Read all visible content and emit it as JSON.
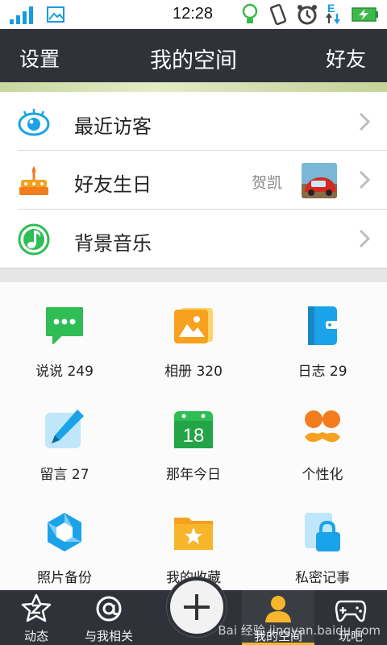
{
  "status_bar": {
    "time": "12:28",
    "network_type": "E"
  },
  "header": {
    "left_label": "设置",
    "title": "我的空间",
    "right_label": "好友"
  },
  "list": [
    {
      "label": "最近访客",
      "icon": "eye-icon",
      "extra": ""
    },
    {
      "label": "好友生日",
      "icon": "birthday-cake-icon",
      "extra": "贺凯"
    },
    {
      "label": "背景音乐",
      "icon": "music-note-icon",
      "extra": ""
    }
  ],
  "grid": [
    {
      "label": "说说 249",
      "icon": "chat-bubble-icon"
    },
    {
      "label": "相册 320",
      "icon": "photo-album-icon"
    },
    {
      "label": "日志 29",
      "icon": "diary-icon"
    },
    {
      "label": "留言 27",
      "icon": "pen-icon"
    },
    {
      "label": "那年今日",
      "icon": "calendar-icon",
      "badge": "18"
    },
    {
      "label": "个性化",
      "icon": "mustache-glasses-icon"
    },
    {
      "label": "照片备份",
      "icon": "aperture-icon"
    },
    {
      "label": "我的收藏",
      "icon": "star-folder-icon"
    },
    {
      "label": "私密记事",
      "icon": "lock-note-icon"
    }
  ],
  "tabbar": {
    "tabs": [
      {
        "label": "动态",
        "icon": "z-star-icon",
        "active": false
      },
      {
        "label": "与我相关",
        "icon": "at-icon",
        "active": false
      },
      {
        "label": "我的空间",
        "icon": "user-icon",
        "active": true
      },
      {
        "label": "玩吧",
        "icon": "gamepad-icon",
        "active": false
      }
    ],
    "center_button": "plus-icon"
  },
  "watermark": "Bai 经验 jingyan.baidu.com",
  "colors": {
    "header_bg": "#2f3239",
    "active_tab_indicator": "#f7b52c",
    "accent_blue": "#1aa3e8",
    "accent_green": "#2fbd55",
    "accent_orange": "#f7a11e"
  }
}
